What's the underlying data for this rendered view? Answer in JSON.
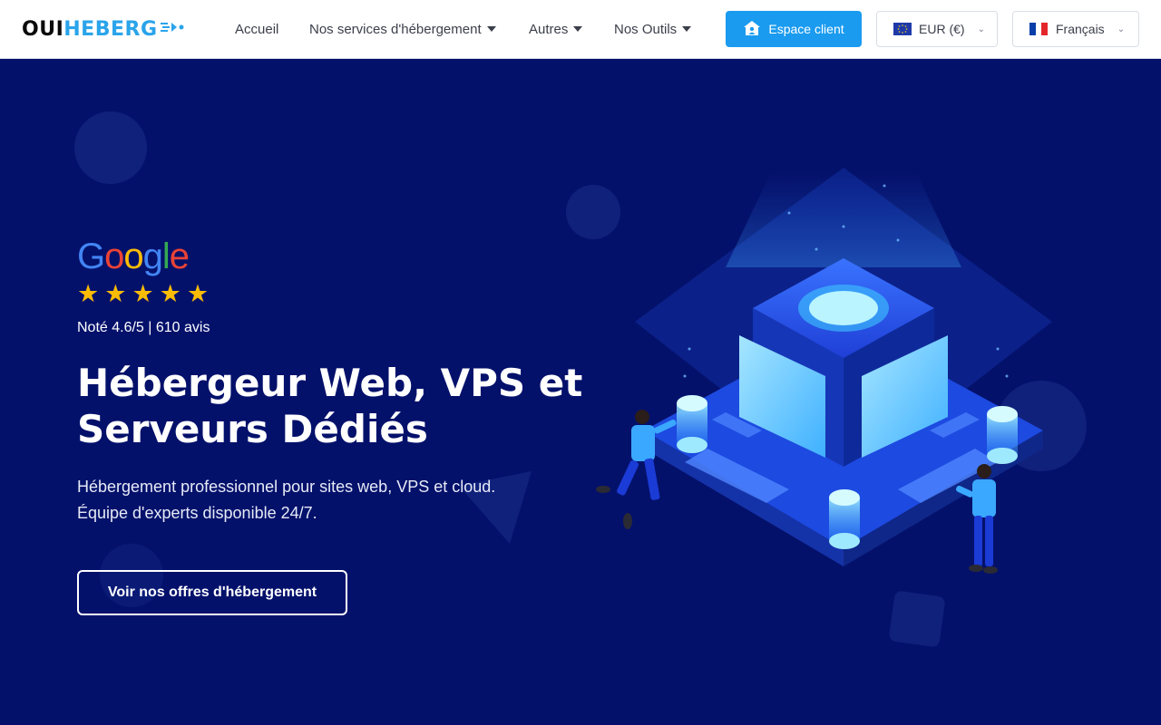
{
  "brand": {
    "logo_part1": "OUI",
    "logo_part2": "HEBERG",
    "colors": {
      "dark": "#0b0b0b",
      "accent": "#2aa4ea"
    }
  },
  "nav": {
    "items": [
      {
        "label": "Accueil",
        "has_dropdown": false
      },
      {
        "label": "Nos services d'hébergement",
        "has_dropdown": true
      },
      {
        "label": "Autres",
        "has_dropdown": true
      },
      {
        "label": "Nos Outils",
        "has_dropdown": true
      }
    ]
  },
  "header_actions": {
    "client_button": {
      "label": "Espace client",
      "icon": "home-user-icon",
      "color": "#1a9bf0"
    },
    "currency": {
      "value": "EUR (€)",
      "icon": "eu-flag-icon"
    },
    "language": {
      "value": "Français",
      "icon": "fr-flag-icon"
    }
  },
  "hero": {
    "review_brand": "Google",
    "stars": 5,
    "rating_text": "Noté 4.6/5 | 610 avis",
    "title_line1": "Hébergeur Web, VPS et",
    "title_line2": "Serveurs Dédiés",
    "subtitle_line1": "Hébergement professionnel pour sites web, VPS et cloud.",
    "subtitle_line2": "Équipe d'experts disponible 24/7.",
    "cta_label": "Voir nos offres d'hébergement",
    "background_color": "#04116b",
    "illustration": "isometric-data-center-illustration"
  }
}
